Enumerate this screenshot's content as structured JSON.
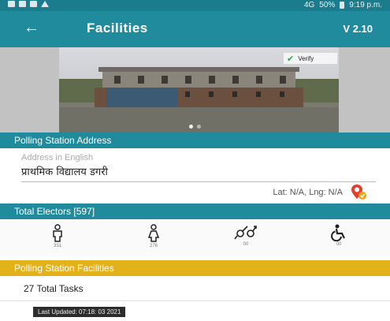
{
  "status_bar": {
    "network": "4G",
    "battery": "50%",
    "time": "9:19 p.m."
  },
  "app_bar": {
    "title": "Facilities",
    "version": "V 2.10"
  },
  "photo": {
    "verify_label": "Verify"
  },
  "address_section": {
    "header": "Polling Station Address",
    "field_label": "Address in English",
    "field_value": "प्राथमिक विद्यालय डगरी",
    "coordinates": "Lat: N/A, Lng: N/A"
  },
  "voters_section": {
    "header": "Total Electors [597]",
    "items": [
      {
        "icon": "male-voter-icon",
        "count": "331"
      },
      {
        "icon": "female-voter-icon",
        "count": "276"
      },
      {
        "icon": "third-gender-icon",
        "count": "00"
      },
      {
        "icon": "disabled-voter-icon",
        "count": "00"
      }
    ]
  },
  "facilities_section": {
    "header": "Polling Station Facilities",
    "tasks": "27 Total Tasks",
    "last_updated": "Last Updated: 07:18: 03 2021"
  },
  "colors": {
    "primary": "#218b9e",
    "accent": "#e3b21a"
  }
}
